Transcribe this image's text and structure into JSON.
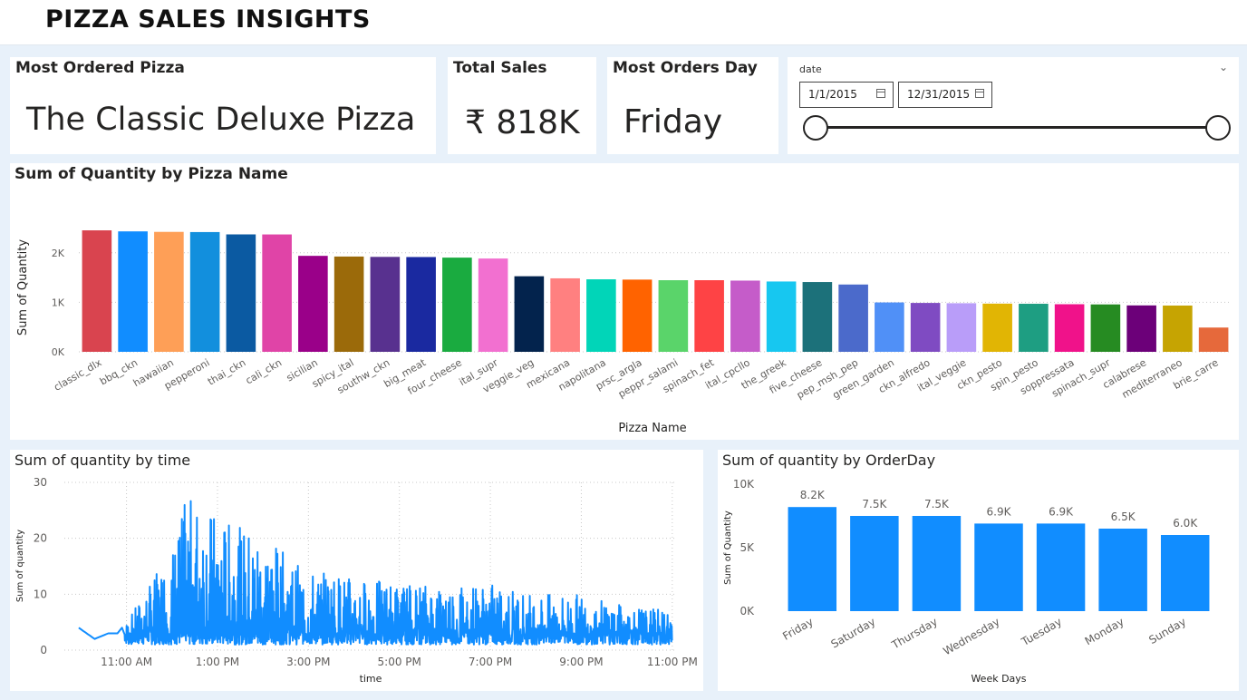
{
  "header": {
    "title": "PIZZA SALES INSIGHTS"
  },
  "cards": {
    "most_ordered": {
      "title": "Most Ordered Pizza",
      "value": "The Classic Deluxe Pizza"
    },
    "total_sales": {
      "title": "Total Sales",
      "value": "₹ 818K"
    },
    "most_orders_day": {
      "title": "Most Orders Day",
      "value": "Friday"
    }
  },
  "date_slicer": {
    "label": "date",
    "start": "1/1/2015",
    "end": "12/31/2015"
  },
  "chart_data": [
    {
      "type": "bar",
      "title": "Sum of Quantity by Pizza Name",
      "xlabel": "Pizza Name",
      "ylabel": "Sum of Quantity",
      "ylim": [
        0,
        2600
      ],
      "yticks": [
        0,
        1000,
        2000
      ],
      "ytick_labels": [
        "0K",
        "1K",
        "2K"
      ],
      "grid": true,
      "categories": [
        "classic_dlx",
        "bbq_ckn",
        "hawaiian",
        "pepperoni",
        "thai_ckn",
        "cali_ckn",
        "sicilian",
        "spicy_ital",
        "southw_ckn",
        "big_meat",
        "four_cheese",
        "ital_supr",
        "veggie_veg",
        "mexicana",
        "napolitana",
        "prsc_argla",
        "peppr_salami",
        "spinach_fet",
        "ital_cpcllo",
        "the_greek",
        "five_cheese",
        "pep_msh_pep",
        "green_garden",
        "ckn_alfredo",
        "ital_veggie",
        "ckn_pesto",
        "spin_pesto",
        "soppressata",
        "spinach_supr",
        "calabrese",
        "mediterraneo",
        "brie_carre"
      ],
      "values": [
        2453,
        2432,
        2422,
        2418,
        2371,
        2370,
        1938,
        1924,
        1917,
        1914,
        1902,
        1884,
        1526,
        1484,
        1464,
        1458,
        1446,
        1446,
        1438,
        1420,
        1409,
        1359,
        997,
        987,
        981,
        973,
        970,
        961,
        957,
        937,
        934,
        490
      ],
      "colors": [
        "#d9444f",
        "#118dff",
        "#fe9f57",
        "#128fdd",
        "#0b5aa2",
        "#e044a7",
        "#9a0089",
        "#9b6a0a",
        "#58318f",
        "#1a29a0",
        "#1aab40",
        "#f270d0",
        "#03234d",
        "#ff8080",
        "#01d5b8",
        "#ff6300",
        "#5ad46a",
        "#fe4345",
        "#c55cc9",
        "#17c7f0",
        "#1c717a",
        "#4b6acb",
        "#5090f7",
        "#7f4bc2",
        "#b99df9",
        "#e1b504",
        "#1e9e82",
        "#f0128a",
        "#268b22",
        "#6c0079",
        "#c6a402",
        "#e6693b"
      ]
    },
    {
      "type": "line",
      "title": "Sum of quantity by time",
      "xlabel": "time",
      "ylabel": "Sum of quantity",
      "ylim": [
        0,
        30
      ],
      "yticks": [
        0,
        10,
        20,
        30
      ],
      "xticks": [
        "11:00 AM",
        "1:00 PM",
        "3:00 PM",
        "5:00 PM",
        "7:00 PM",
        "9:00 PM",
        "11:00 PM"
      ],
      "xlim": [
        "9:38 AM",
        "11:05 PM"
      ],
      "grid": true,
      "color": "#118dff",
      "profile": {
        "hours": [
          9.95,
          10.3,
          10.6,
          10.8,
          11.0,
          11.3,
          11.6,
          12.0,
          12.3,
          12.6,
          13.0,
          13.5,
          14.0,
          14.5,
          15.0,
          15.5,
          16.0,
          17.0,
          18.0,
          19.0,
          20.0,
          21.0,
          22.0,
          23.0
        ],
        "peak": [
          4,
          2,
          3,
          3,
          5,
          9,
          13,
          18,
          27,
          27,
          24,
          22,
          21,
          17,
          14,
          14,
          13,
          12,
          12,
          12,
          10,
          10,
          8,
          7
        ],
        "base": [
          4,
          2,
          3,
          3,
          1,
          1,
          1,
          1,
          1,
          1,
          1,
          1,
          1,
          1,
          1,
          1,
          1,
          1,
          1,
          1,
          1,
          1,
          1,
          1
        ]
      }
    },
    {
      "type": "bar",
      "title": "Sum of quantity by OrderDay",
      "xlabel": "Week Days",
      "ylabel": "Sum of Quantity",
      "ylim": [
        0,
        10000
      ],
      "yticks": [
        0,
        5000,
        10000
      ],
      "ytick_labels": [
        "0K",
        "5K",
        "10K"
      ],
      "categories": [
        "Friday",
        "Saturday",
        "Thursday",
        "Wednesday",
        "Tuesday",
        "Monday",
        "Sunday"
      ],
      "values": [
        8200,
        7500,
        7500,
        6900,
        6900,
        6500,
        6000
      ],
      "data_labels": [
        "8.2K",
        "7.5K",
        "7.5K",
        "6.9K",
        "6.9K",
        "6.5K",
        "6.0K"
      ],
      "color": "#118dff"
    }
  ]
}
